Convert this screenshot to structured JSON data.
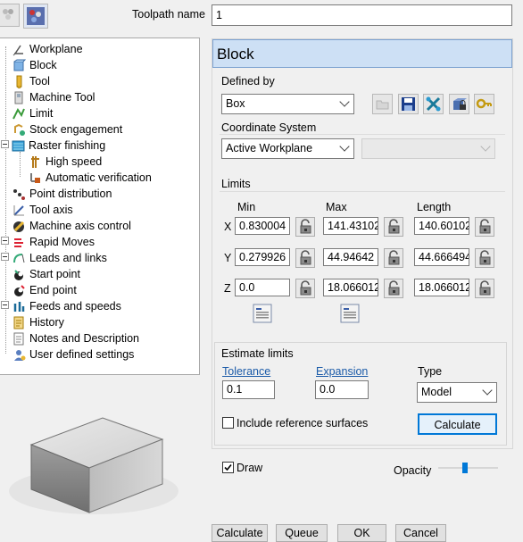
{
  "header": {
    "label": "Toolpath name",
    "value": "1"
  },
  "tree": {
    "items": [
      {
        "label": "Workplane"
      },
      {
        "label": "Block"
      },
      {
        "label": "Tool"
      },
      {
        "label": "Machine Tool"
      },
      {
        "label": "Limit"
      },
      {
        "label": "Stock engagement"
      },
      {
        "label": "Raster finishing"
      },
      {
        "label": "High speed"
      },
      {
        "label": "Automatic verification"
      },
      {
        "label": "Point distribution"
      },
      {
        "label": "Tool axis"
      },
      {
        "label": "Machine axis control"
      },
      {
        "label": "Rapid Moves"
      },
      {
        "label": "Leads and links"
      },
      {
        "label": "Start point"
      },
      {
        "label": "End point"
      },
      {
        "label": "Feeds and speeds"
      },
      {
        "label": "History"
      },
      {
        "label": "Notes and Description"
      },
      {
        "label": "User defined settings"
      }
    ]
  },
  "panel": {
    "title": "Block",
    "defined_by": {
      "label": "Defined by",
      "value": "Box"
    },
    "coord": {
      "label": "Coordinate System",
      "value": "Active Workplane",
      "second_value": ""
    }
  },
  "limits": {
    "title": "Limits",
    "headers": {
      "min": "Min",
      "max": "Max",
      "length": "Length"
    },
    "rows": [
      {
        "axis": "X",
        "min": "0.830004",
        "max": "141.43102",
        "length": "140.60102"
      },
      {
        "axis": "Y",
        "min": "0.279926",
        "max": "44.94642",
        "length": "44.666494"
      },
      {
        "axis": "Z",
        "min": "0.0",
        "max": "18.066012",
        "length": "18.066012"
      }
    ]
  },
  "estimate": {
    "title": "Estimate limits",
    "tolerance_label": "Tolerance",
    "tolerance": "0.1",
    "expansion_label": "Expansion",
    "expansion": "0.0",
    "type_label": "Type",
    "type_value": "Model",
    "include_label": "Include reference surfaces",
    "include_checked": false,
    "calculate": "Calculate"
  },
  "draw": {
    "label": "Draw",
    "checked": true,
    "opacity_label": "Opacity",
    "opacity": 0.45
  },
  "footer": {
    "buttons": [
      "Calculate",
      "Queue",
      "OK",
      "Cancel"
    ]
  },
  "colors": {
    "title_bar": "#cde0f5",
    "accent": "#1a5aa8",
    "calc_border": "#0078d7"
  }
}
